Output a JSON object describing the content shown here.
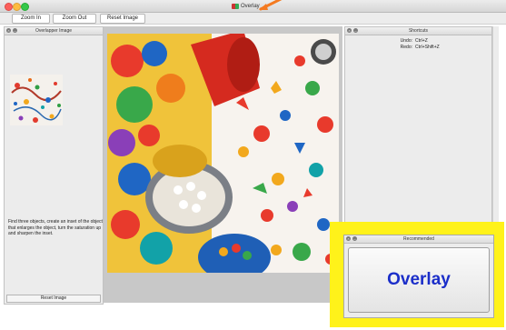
{
  "window": {
    "title": "Overlay",
    "traffic_lights": [
      "close",
      "minimize",
      "maximize"
    ]
  },
  "toolbar": {
    "zoom_in_label": "Zoom In",
    "zoom_out_label": "Zoom Out",
    "reset_image_label": "Reset Image"
  },
  "left_panel": {
    "title": "Overlapper Image",
    "instructions": "Find three objects, create an inset of the object that enlarges the object, turn the saturation up and sharpen the inset.",
    "reset_button_label": "Reset Image"
  },
  "right_panel": {
    "title": "Shortcuts",
    "shortcuts": [
      {
        "action": "Undo:",
        "keys": "Ctrl+Z"
      },
      {
        "action": "Redo:",
        "keys": "Ctrl+Shift+Z"
      }
    ]
  },
  "recommended_panel": {
    "title": "Recommended",
    "button_label": "Overlay"
  },
  "colors": {
    "highlight": "#fff21a",
    "overlay_text": "#1b2ec9",
    "annotation_arrow": "#f47a20"
  },
  "icons": {
    "panel_close": "close-icon",
    "panel_minimize": "minimize-icon",
    "app": "app-icon"
  }
}
